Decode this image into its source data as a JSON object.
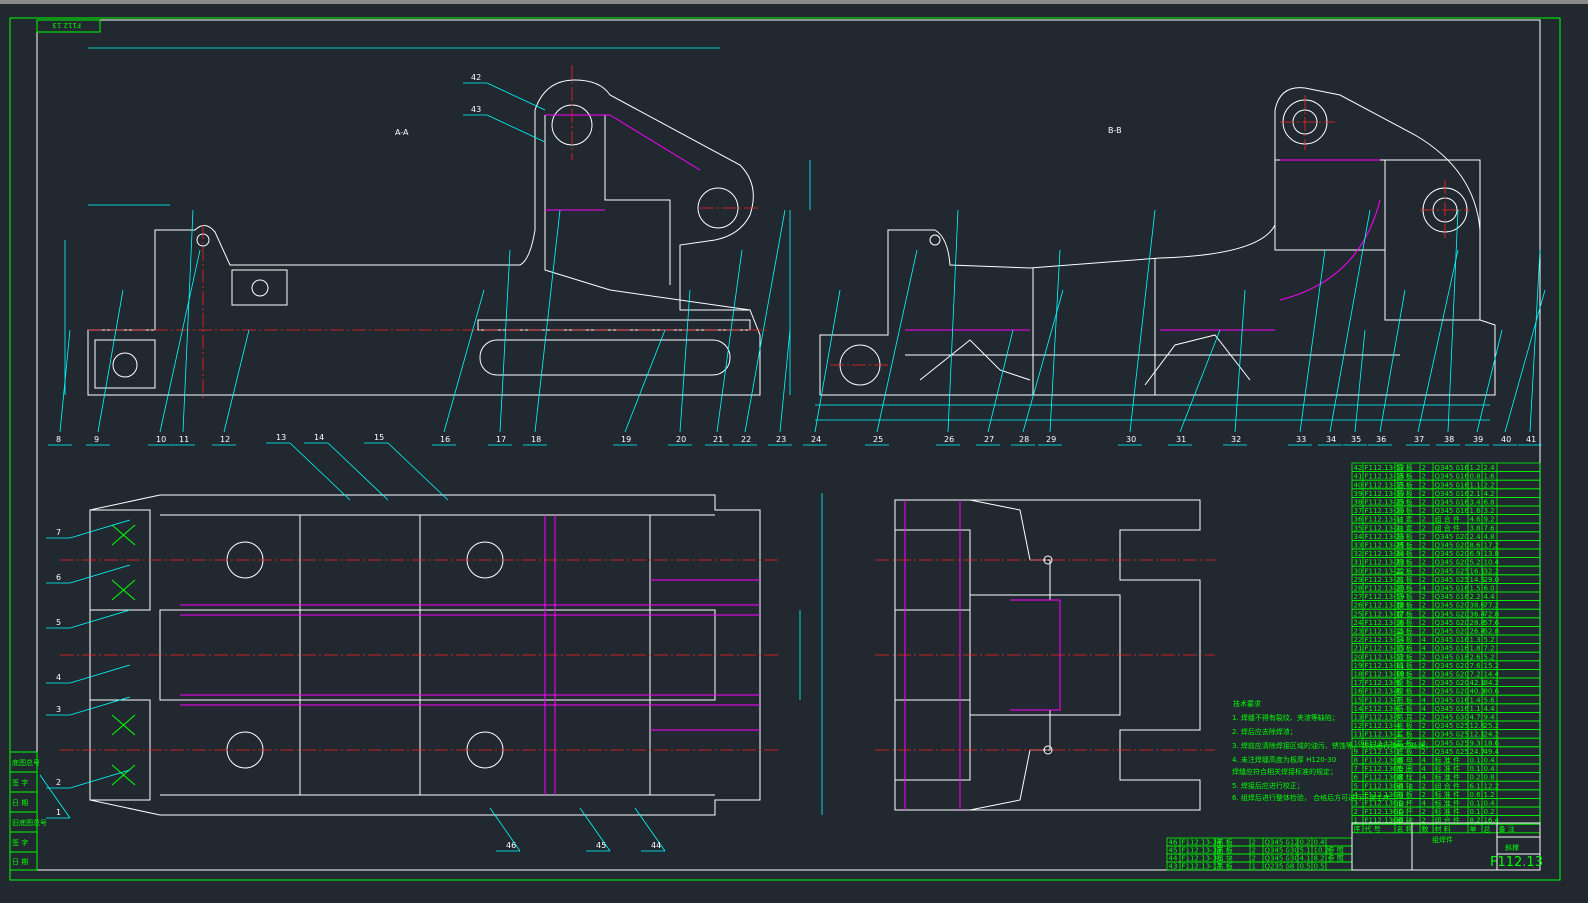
{
  "drawing": {
    "code_mirrored": "F112.13",
    "drawing_number": "F112.13",
    "name": "斜撑",
    "assembly_label": "组焊件",
    "section_labels": [
      "A-A",
      "B-B"
    ],
    "tech_title": "技术要求",
    "tech_notes": [
      "1. 焊缝不得有裂纹、夹渣等缺陷；",
      "2. 焊后应去除焊渣；",
      "3. 焊前应清除焊接区域的油污、锈蚀等，  焊后进行消应力处理；",
      "4. 未注焊缝高度为板厚 H120-30",
      "   焊缝应符合相关焊接标准的规定；",
      "5. 焊接后应进行校正；",
      "6. 组焊后进行整体检验，  合格后方可进行下道工序。"
    ],
    "side_labels": [
      "底图总号",
      "签 字",
      "日 期",
      "旧底图总号",
      "签 字",
      "日 期"
    ]
  },
  "balloons_top": [
    "8",
    "9",
    "10",
    "11",
    "12",
    "16",
    "17",
    "18",
    "19",
    "20",
    "21",
    "22",
    "23",
    "24",
    "25",
    "26",
    "27",
    "28",
    "29",
    "30",
    "31",
    "32",
    "33",
    "34",
    "35",
    "36",
    "37",
    "38",
    "39",
    "40",
    "41",
    "42",
    "43"
  ],
  "balloons_bottom": [
    "1",
    "2",
    "3",
    "4",
    "5",
    "6",
    "7",
    "13",
    "14",
    "15",
    "44",
    "45",
    "46"
  ],
  "bom": [
    [
      "42",
      "F112.13-12",
      "筋 板",
      "2",
      "Q345 δ16",
      "1.2",
      "2.4",
      ""
    ],
    [
      "41",
      "F112.13-16",
      "筋 板",
      "2",
      "Q345 δ16",
      "0.8",
      "1.6",
      ""
    ],
    [
      "40",
      "F112.13-15",
      "筋 板",
      "2",
      "Q345 δ16",
      "1.1",
      "2.2",
      ""
    ],
    [
      "39",
      "F112.13-30",
      "筋 板",
      "2",
      "Q345 δ16",
      "2.1",
      "4.2",
      ""
    ],
    [
      "38",
      "F112.13-29",
      "筋 板",
      "2",
      "Q345 δ16",
      "3.4",
      "6.8",
      ""
    ],
    [
      "37",
      "F112.13-28",
      "筋 板",
      "2",
      "Q345 δ16",
      "1.6",
      "3.2",
      ""
    ],
    [
      "36",
      "F112.13-1",
      "轴 套",
      "2",
      "组 合 件",
      "4.6",
      "9.2",
      ""
    ],
    [
      "35",
      "F112.13-2",
      "轴 套",
      "2",
      "组 合 件",
      "3.8",
      "7.6",
      ""
    ],
    [
      "34",
      "F112.13-26",
      "筋 板",
      "2",
      "Q345 δ20",
      "2.4",
      "4.8",
      ""
    ],
    [
      "33",
      "F112.13-25",
      "隔 板",
      "2",
      "Q345 δ20",
      "8.6",
      "17.2",
      ""
    ],
    [
      "32",
      "F112.13-24",
      "隔 板",
      "2",
      "Q345 δ20",
      "6.9",
      "13.8",
      ""
    ],
    [
      "31",
      "F112.13-23",
      "隔 板",
      "2",
      "Q345 δ20",
      "5.2",
      "10.4",
      ""
    ],
    [
      "30",
      "F112.13-22",
      "盖 板",
      "2",
      "Q345 δ25",
      "16.1",
      "32.2",
      ""
    ],
    [
      "29",
      "F112.13-21",
      "盖 板",
      "2",
      "Q345 δ25",
      "14.5",
      "29.0",
      ""
    ],
    [
      "28",
      "F112.13-20",
      "筋 板",
      "4",
      "Q345 δ16",
      "1.5",
      "6.0",
      ""
    ],
    [
      "27",
      "F112.13-19",
      "筋 板",
      "2",
      "Q345 δ16",
      "2.2",
      "4.4",
      ""
    ],
    [
      "26",
      "F112.13-18",
      "腹 板",
      "2",
      "Q345 δ20",
      "38.6",
      "77.2",
      ""
    ],
    [
      "25",
      "F112.13-17",
      "腹 板",
      "2",
      "Q345 δ20",
      "36.4",
      "72.8",
      ""
    ],
    [
      "24",
      "F112.13-16",
      "盖 板",
      "2",
      "Q345 δ20",
      "28.8",
      "57.6",
      ""
    ],
    [
      "23",
      "F112.13-15",
      "盖 板",
      "2",
      "Q345 δ20",
      "26.4",
      "52.8",
      ""
    ],
    [
      "22",
      "F112.13-14",
      "筋 板",
      "4",
      "Q345 δ16",
      "1.3",
      "5.2",
      ""
    ],
    [
      "21",
      "F112.13-13",
      "筋 板",
      "4",
      "Q345 δ16",
      "1.8",
      "7.2",
      ""
    ],
    [
      "20",
      "F112.13-12",
      "筋 板",
      "2",
      "Q345 δ16",
      "2.6",
      "5.2",
      ""
    ],
    [
      "19",
      "F112.13-11",
      "隔 板",
      "2",
      "Q345 δ20",
      "7.6",
      "15.2",
      ""
    ],
    [
      "18",
      "F112.13-10",
      "隔 板",
      "2",
      "Q345 δ20",
      "7.2",
      "14.4",
      ""
    ],
    [
      "17",
      "F112.13-9",
      "腹 板",
      "2",
      "Q345 δ20",
      "42.1",
      "84.2",
      ""
    ],
    [
      "16",
      "F112.13-8",
      "腹 板",
      "2",
      "Q345 δ20",
      "40.3",
      "80.6",
      ""
    ],
    [
      "15",
      "F112.13-7",
      "筋 板",
      "4",
      "Q345 δ16",
      "1.4",
      "5.6",
      ""
    ],
    [
      "14",
      "F112.13-6",
      "筋 板",
      "4",
      "Q345 δ16",
      "1.1",
      "4.4",
      ""
    ],
    [
      "13",
      "F112.13-5",
      "吊 耳",
      "2",
      "Q345 δ30",
      "4.7",
      "9.4",
      ""
    ],
    [
      "12",
      "F112.13-4",
      "盖 板",
      "2",
      "Q345 δ25",
      "12.6",
      "25.2",
      ""
    ],
    [
      "11",
      "F112.13-3",
      "盖 板",
      "2",
      "Q345 δ25",
      "12.1",
      "24.2",
      ""
    ],
    [
      "10",
      "F112.13-2",
      "盖 板",
      "2",
      "Q345 δ25",
      "9.3",
      "18.6",
      ""
    ],
    [
      "9",
      "F112.13-1",
      "底 板",
      "2",
      "Q345 δ25",
      "24.7",
      "49.4",
      ""
    ],
    [
      "8",
      "F112.13GB",
      "螺 母",
      "4",
      "标 准 件",
      "0.1",
      "0.4",
      ""
    ],
    [
      "7",
      "F112.13GB",
      "垫 圈",
      "4",
      "标 准 件",
      "0.1",
      "0.4",
      ""
    ],
    [
      "6",
      "F112.13GB",
      "螺 栓",
      "4",
      "标 准 件",
      "0.2",
      "0.8",
      ""
    ],
    [
      "5",
      "F112.13GB",
      "销 轴",
      "2",
      "组 合 件",
      "6.1",
      "12.2",
      ""
    ],
    [
      "4",
      "F112.13GB",
      "挡 板",
      "2",
      "标 准 件",
      "0.6",
      "1.2",
      ""
    ],
    [
      "3",
      "F112.13GD",
      "油 杯",
      "4",
      "标 准 件",
      "0.1",
      "0.4",
      ""
    ],
    [
      "2",
      "F112.13GD",
      "油 杯",
      "2",
      "标 准 件",
      "0.1",
      "0.2",
      ""
    ],
    [
      "1",
      "F112.13GB",
      "销 轴",
      "2",
      "组 合 件",
      "8.2",
      "16.4",
      ""
    ]
  ],
  "bom_bottom": [
    [
      "46",
      "F112.13-34",
      "筋 板",
      "2",
      "Q345 δ12",
      "0.2",
      "0.4",
      ""
    ],
    [
      "45",
      "F112.13-33",
      "筋 板",
      "2",
      "Q345 δ30",
      "5.1",
      "10.2",
      "参 照"
    ],
    [
      "44",
      "F112.13-36",
      "挡 块",
      "2",
      "Q345 δ30",
      "4.1",
      "8.2",
      "参 照"
    ],
    [
      "43",
      "F112.13-13",
      "吊 板",
      "1",
      "Q235 δ8",
      "0.5",
      "0.5",
      ""
    ]
  ],
  "bom_header": [
    "序",
    "代 号",
    "名 称",
    "数",
    "材 料",
    "单",
    "总",
    "备 注"
  ]
}
